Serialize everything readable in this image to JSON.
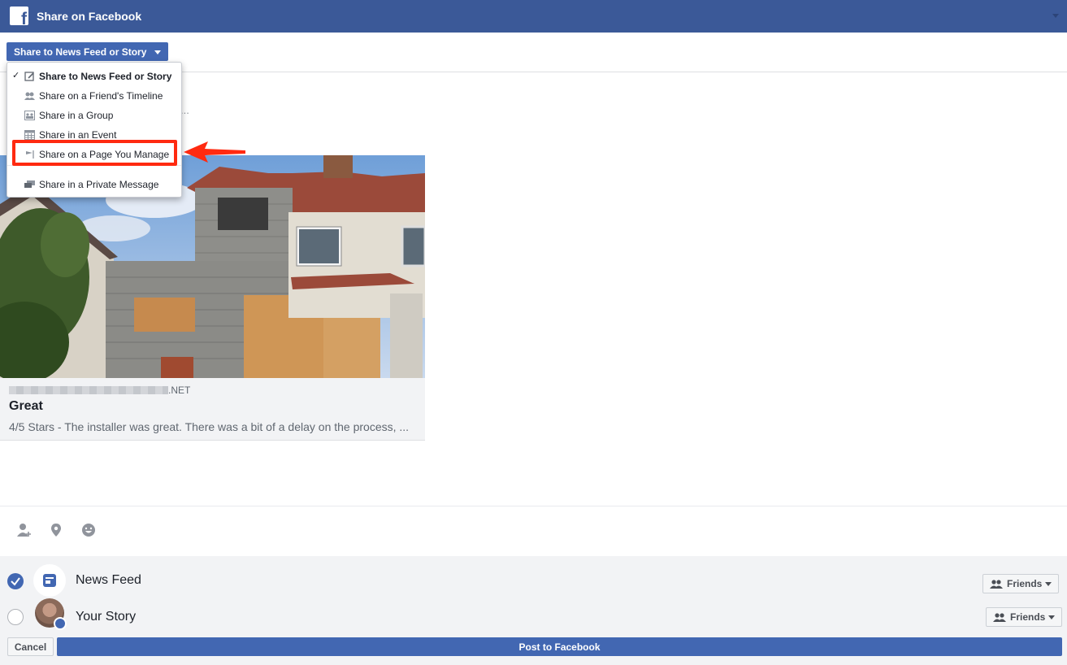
{
  "header": {
    "title": "Share on Facebook",
    "logo_letter": "f"
  },
  "share_selector": {
    "label": "Share to News Feed or Story"
  },
  "composer": {
    "placeholder_tail": "..."
  },
  "menu": {
    "items": [
      {
        "label": "Share to News Feed or Story",
        "icon": "edit-icon",
        "selected": true
      },
      {
        "label": "Share on a Friend's Timeline",
        "icon": "friend-icon"
      },
      {
        "label": "Share in a Group",
        "icon": "group-icon"
      },
      {
        "label": "Share in an Event",
        "icon": "calendar-icon"
      },
      {
        "label": "Share on a Page You Manage",
        "icon": "flag-icon",
        "highlighted": true
      },
      {
        "label": "Share in a Private Message",
        "icon": "message-icon"
      }
    ],
    "check_glyph": "✓"
  },
  "link_preview": {
    "domain_suffix": ".NET",
    "title": "Great",
    "description": "4/5 Stars - The installer was great. There was a bit of a delay on the process, ..."
  },
  "toolbar": {
    "icons": [
      "tag-friends-icon",
      "location-icon",
      "feeling-icon"
    ]
  },
  "destinations": [
    {
      "label": "News Feed",
      "checked": true,
      "audience": "Friends"
    },
    {
      "label": "Your Story",
      "checked": false,
      "audience": "Friends"
    }
  ],
  "actions": {
    "cancel": "Cancel",
    "post": "Post to Facebook"
  },
  "colors": {
    "brand": "#3b5998",
    "button": "#4267b2",
    "annotation": "#ff2a10"
  }
}
